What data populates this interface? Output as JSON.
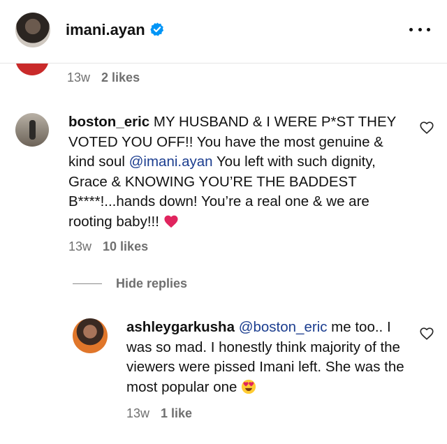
{
  "header": {
    "username": "imani.ayan",
    "verified_icon": "verified-badge-icon",
    "more_icon": "more-horizontal-icon"
  },
  "prev_comment": {
    "time": "13w",
    "likes": "2 likes"
  },
  "comment": {
    "username": "boston_eric",
    "text_before": " MY HUSBAND & I WERE P*ST THEY VOTED YOU OFF!! You have the most genuine & kind soul ",
    "mention": "@imani.ayan",
    "text_after": " You left with such dignity, Grace & KNOWING YOU’RE THE BADDEST B****!...hands down! You’re a real one & we are rooting baby!!!",
    "emoji": "heart-emoji",
    "time": "13w",
    "likes": "10 likes"
  },
  "replies_toggle": {
    "label": "Hide replies"
  },
  "reply": {
    "username": "ashleygarkusha",
    "mention": "@boston_eric",
    "text": " me too.. I was so mad. I honestly think majority of the viewers were pissed Imani left. She was the most popular one",
    "emoji": "heart-eyes-emoji",
    "time": "13w",
    "likes": "1 like"
  },
  "colors": {
    "mention": "#1b3d8f",
    "muted": "#6f6f6f",
    "verified": "#0095f6",
    "heart_emoji": "#e0245e"
  }
}
